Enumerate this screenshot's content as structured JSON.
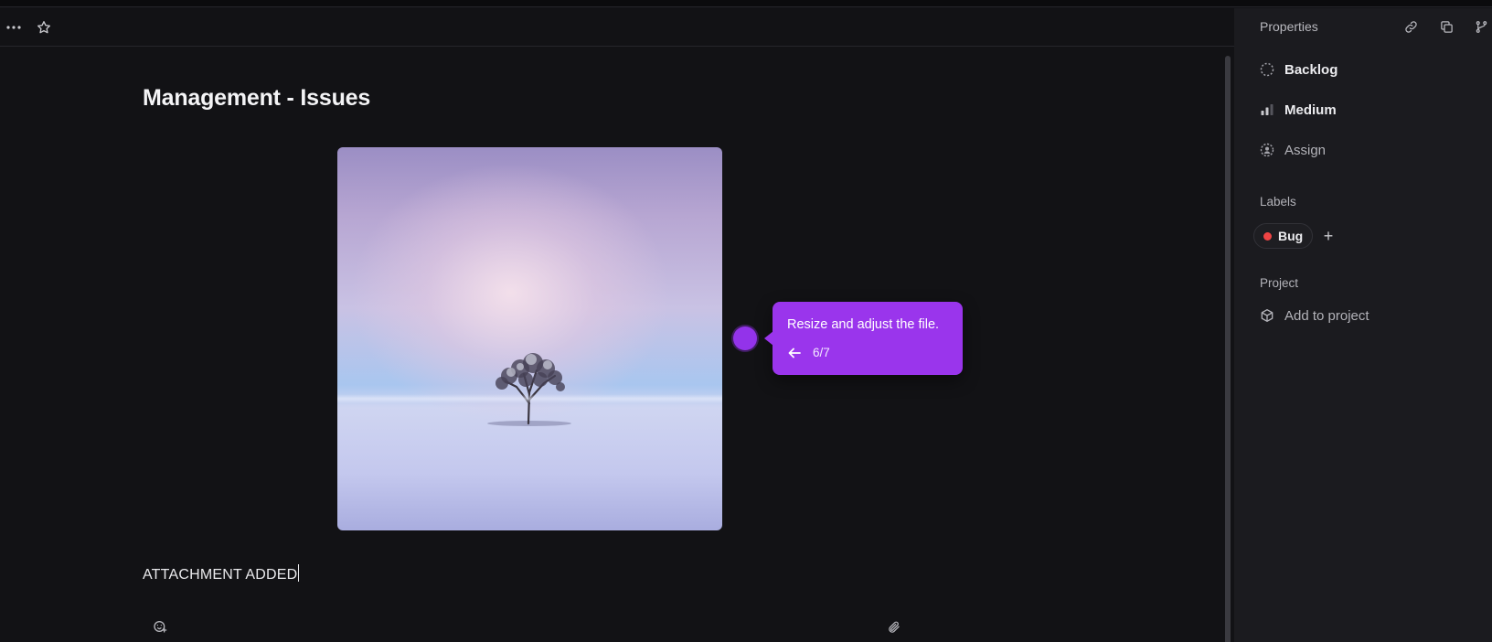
{
  "toolbar": {
    "more_icon": "more-horizontal-icon",
    "star_icon": "star-icon"
  },
  "document": {
    "title": "Management - Issues",
    "image_alt": "Snowy landscape with a lone frosted tree",
    "body_text": "ATTACHMENT ADDED",
    "bottom_icons": [
      "emoji-add-icon",
      "paperclip-icon"
    ]
  },
  "tooltip": {
    "text": "Resize and adjust the file.",
    "step": "6/7",
    "back_icon": "arrow-left-icon"
  },
  "properties": {
    "header": "Properties",
    "header_icons": [
      "link-icon",
      "copy-id-icon",
      "branch-icon"
    ],
    "status": "Backlog",
    "priority": "Medium",
    "assignee": "Assign",
    "labels_title": "Labels",
    "labels": [
      {
        "name": "Bug",
        "color": "#ef4444"
      }
    ],
    "project_title": "Project",
    "project_action": "Add to project"
  },
  "colors": {
    "background": "#121215",
    "panel": "#1b1b1f",
    "accent": "#9a35ec"
  }
}
